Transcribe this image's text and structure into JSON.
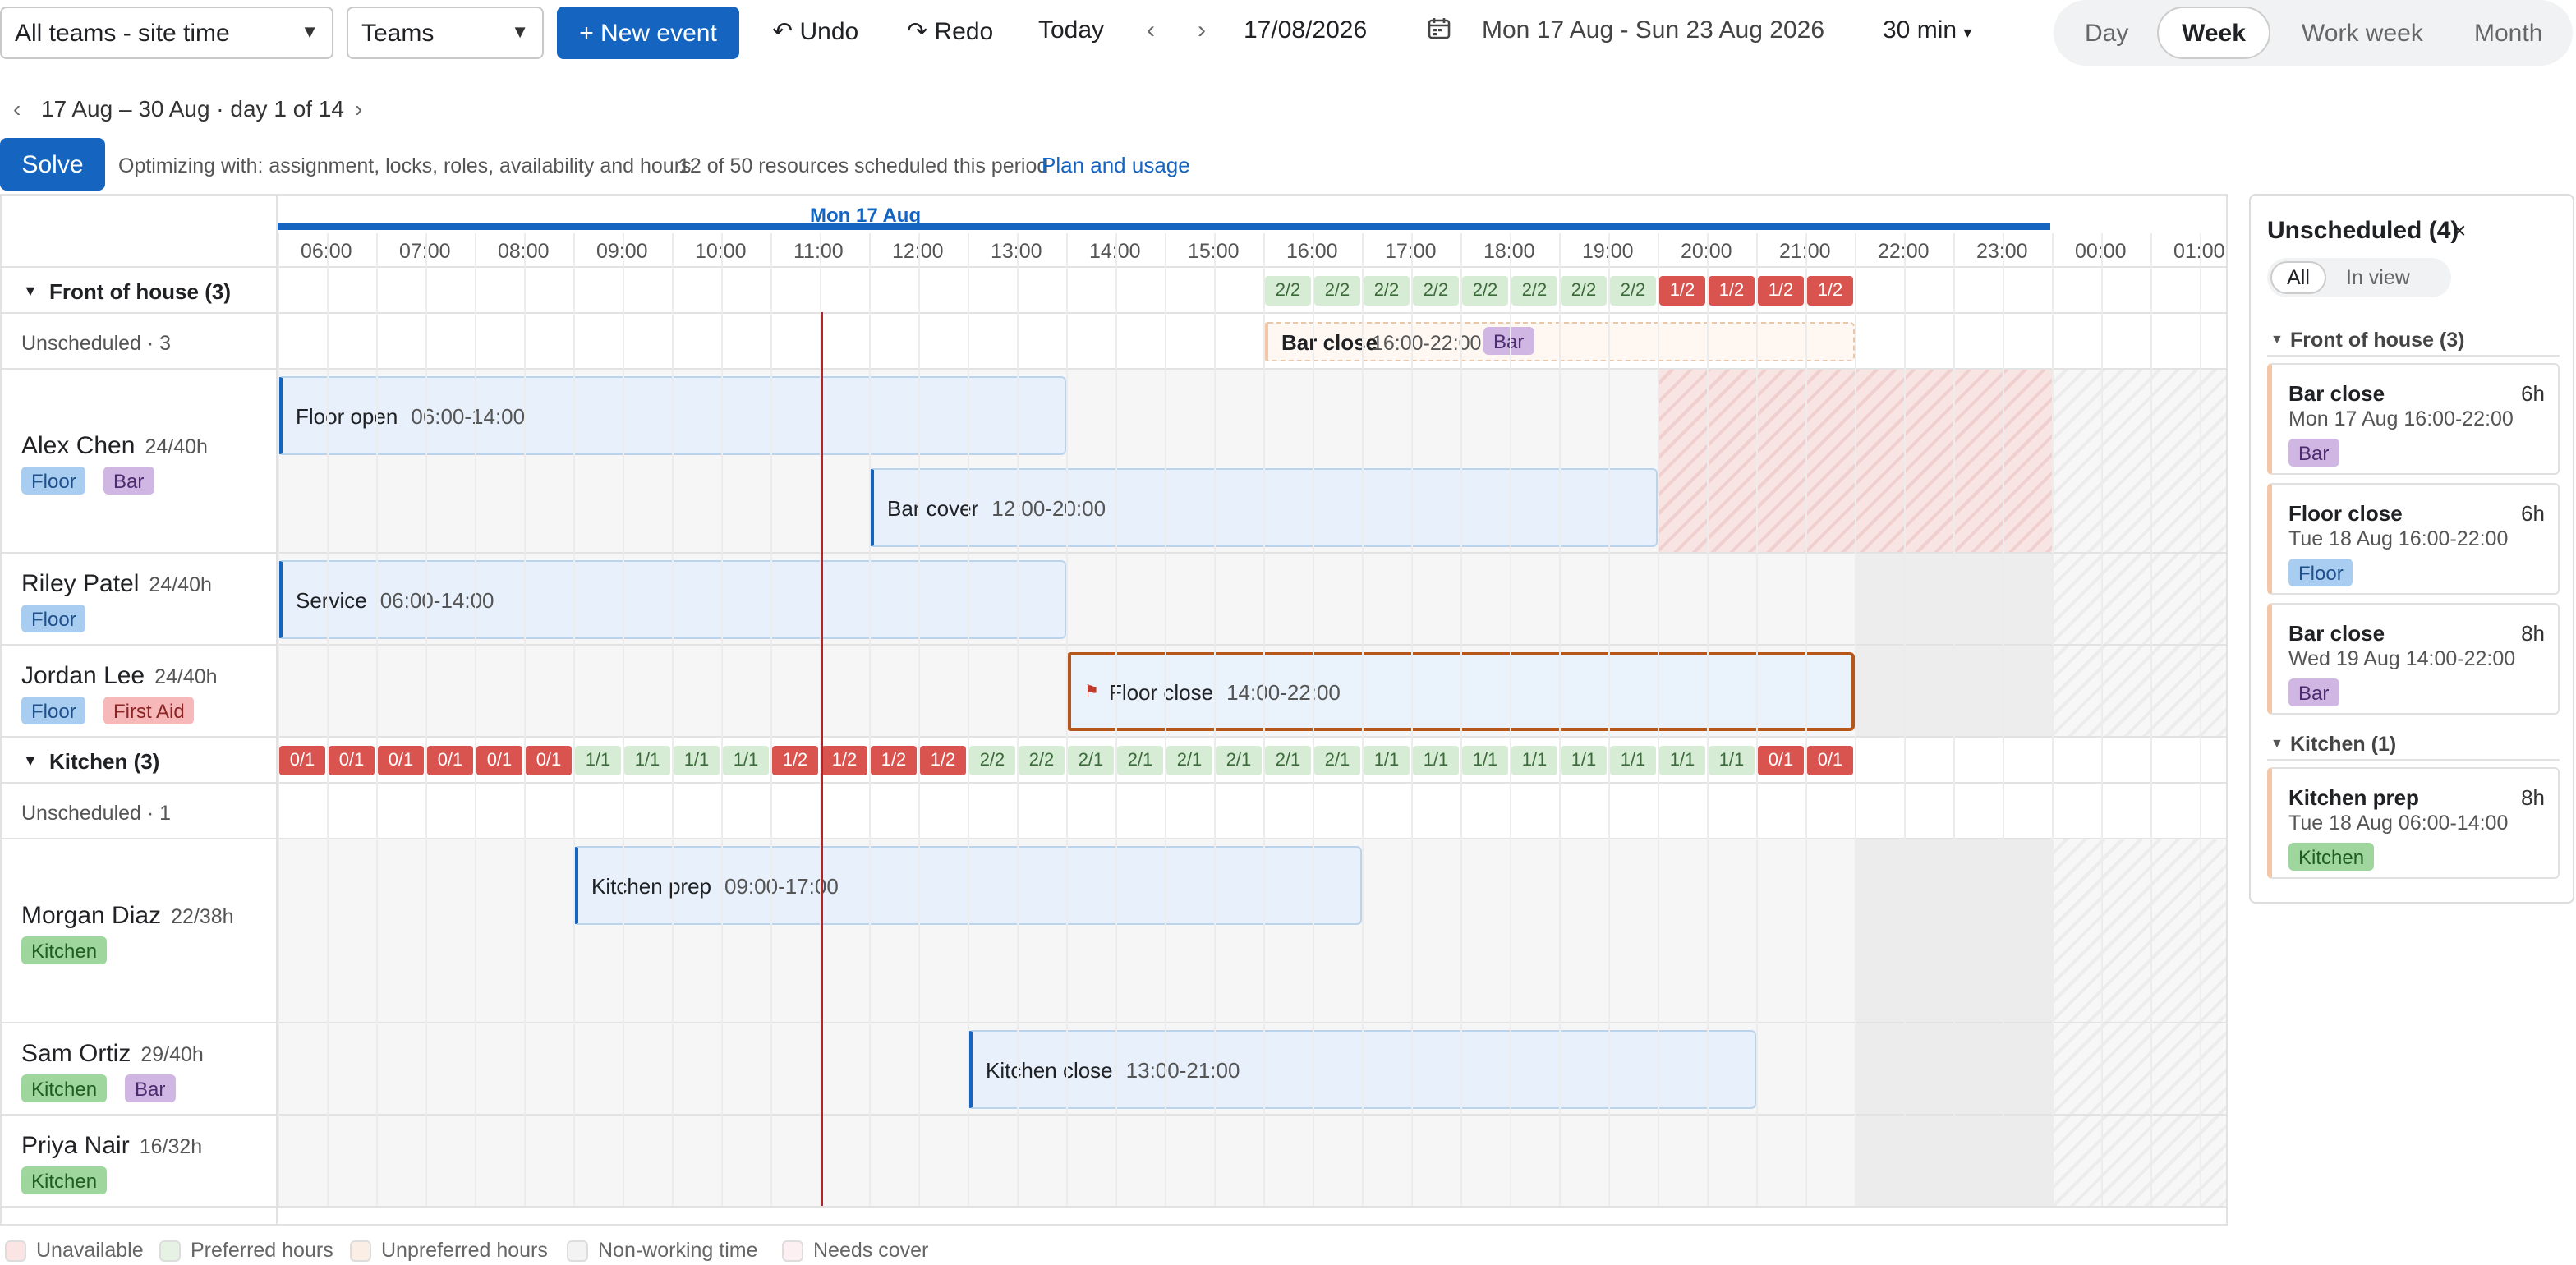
{
  "toolbar": {
    "scope_select": "All teams - site time",
    "group_select": "Teams",
    "new_event": "+ New event",
    "undo": "Undo",
    "redo": "Redo",
    "today": "Today",
    "date": "17/08/2026",
    "range": "Mon 17 Aug - Sun 23 Aug 2026",
    "interval": "30 min",
    "views": [
      "Day",
      "Week",
      "Work week",
      "Month"
    ],
    "active_view": "Week"
  },
  "period": {
    "label": "17 Aug – 30 Aug · day 1 of 14"
  },
  "solve": {
    "button": "Solve",
    "optimizing": "Optimizing with: assignment, locks, roles, availability and hours",
    "scheduled": "12 of 50 resources scheduled this period",
    "plan_link": "Plan and usage"
  },
  "day_header": "Mon 17 Aug",
  "hours": [
    "06:00",
    "07:00",
    "08:00",
    "09:00",
    "10:00",
    "11:00",
    "12:00",
    "13:00",
    "14:00",
    "15:00",
    "16:00",
    "17:00",
    "18:00",
    "19:00",
    "20:00",
    "21:00",
    "22:00",
    "23:00",
    "00:00",
    "01:00"
  ],
  "groups": [
    {
      "name": "Front of house (3)",
      "unscheduled": "Unscheduled · 3",
      "coverage": [
        "2/2",
        "2/2",
        "2/2",
        "2/2",
        "2/2",
        "2/2",
        "2/2",
        "2/2",
        "1/2",
        "1/2",
        "1/2",
        "1/2"
      ],
      "coverage_colors": [
        "g",
        "g",
        "g",
        "g",
        "g",
        "g",
        "g",
        "g",
        "r",
        "r",
        "r",
        "r"
      ],
      "unscheduled_event": {
        "title": "Bar close",
        "time": "16:00-22:00",
        "tag": "Bar"
      },
      "resources": [
        {
          "name": "Alex Chen",
          "hours": "24/40h",
          "tags": [
            "Floor",
            "Bar"
          ],
          "events": [
            {
              "title": "Floor open",
              "time": "06:00-14:00"
            },
            {
              "title": "Bar cover",
              "time": "12:00-20:00"
            }
          ]
        },
        {
          "name": "Riley Patel",
          "hours": "24/40h",
          "tags": [
            "Floor"
          ],
          "events": [
            {
              "title": "Service",
              "time": "06:00-14:00"
            }
          ]
        },
        {
          "name": "Jordan Lee",
          "hours": "24/40h",
          "tags": [
            "Floor",
            "First Aid"
          ],
          "events": [
            {
              "title": "Floor close",
              "time": "14:00-22:00"
            }
          ]
        }
      ]
    },
    {
      "name": "Kitchen (3)",
      "unscheduled": "Unscheduled · 1",
      "coverage": [
        "0/1",
        "0/1",
        "0/1",
        "0/1",
        "0/1",
        "0/1",
        "1/1",
        "1/1",
        "1/1",
        "1/1",
        "1/2",
        "1/2",
        "1/2",
        "1/2",
        "2/2",
        "2/2",
        "2/1",
        "2/1",
        "2/1",
        "2/1",
        "2/1",
        "2/1",
        "1/1",
        "1/1",
        "1/1",
        "1/1",
        "1/1",
        "1/1",
        "1/1",
        "1/1",
        "0/1",
        "0/1"
      ],
      "coverage_colors": [
        "r",
        "r",
        "r",
        "r",
        "r",
        "r",
        "g",
        "g",
        "g",
        "g",
        "r",
        "r",
        "r",
        "r",
        "g",
        "g",
        "g",
        "g",
        "g",
        "g",
        "g",
        "g",
        "g",
        "g",
        "g",
        "g",
        "g",
        "g",
        "g",
        "g",
        "r",
        "r"
      ],
      "resources": [
        {
          "name": "Morgan Diaz",
          "hours": "22/38h",
          "tags": [
            "Kitchen"
          ],
          "events": [
            {
              "title": "Kitchen prep",
              "time": "09:00-17:00"
            }
          ]
        },
        {
          "name": "Sam Ortiz",
          "hours": "29/40h",
          "tags": [
            "Kitchen",
            "Bar"
          ],
          "events": [
            {
              "title": "Kitchen close",
              "time": "13:00-21:00"
            }
          ]
        },
        {
          "name": "Priya Nair",
          "hours": "16/32h",
          "tags": [
            "Kitchen"
          ],
          "events": []
        }
      ]
    }
  ],
  "unscheduled_panel": {
    "title": "Unscheduled (4)",
    "filters": [
      "All",
      "In view"
    ],
    "groups": [
      {
        "name": "Front of house (3)",
        "items": [
          {
            "title": "Bar close",
            "hours": "6h",
            "date": "Mon 17 Aug 16:00-22:00",
            "tag": "Bar"
          },
          {
            "title": "Floor close",
            "hours": "6h",
            "date": "Tue 18 Aug 16:00-22:00",
            "tag": "Floor"
          },
          {
            "title": "Bar close",
            "hours": "8h",
            "date": "Wed 19 Aug 14:00-22:00",
            "tag": "Bar"
          }
        ]
      },
      {
        "name": "Kitchen (1)",
        "items": [
          {
            "title": "Kitchen prep",
            "hours": "8h",
            "date": "Tue 18 Aug 06:00-14:00",
            "tag": "Kitchen"
          }
        ]
      }
    ]
  },
  "legend": [
    "Unavailable",
    "Preferred hours",
    "Unpreferred hours",
    "Non-working time",
    "Needs cover"
  ],
  "colors": {
    "accent": "#1565c0",
    "now_line": "#b0262a",
    "selected_border": "#b5561b",
    "unavailable": "#f6d6d6",
    "preferred": "#d7ecd5"
  }
}
